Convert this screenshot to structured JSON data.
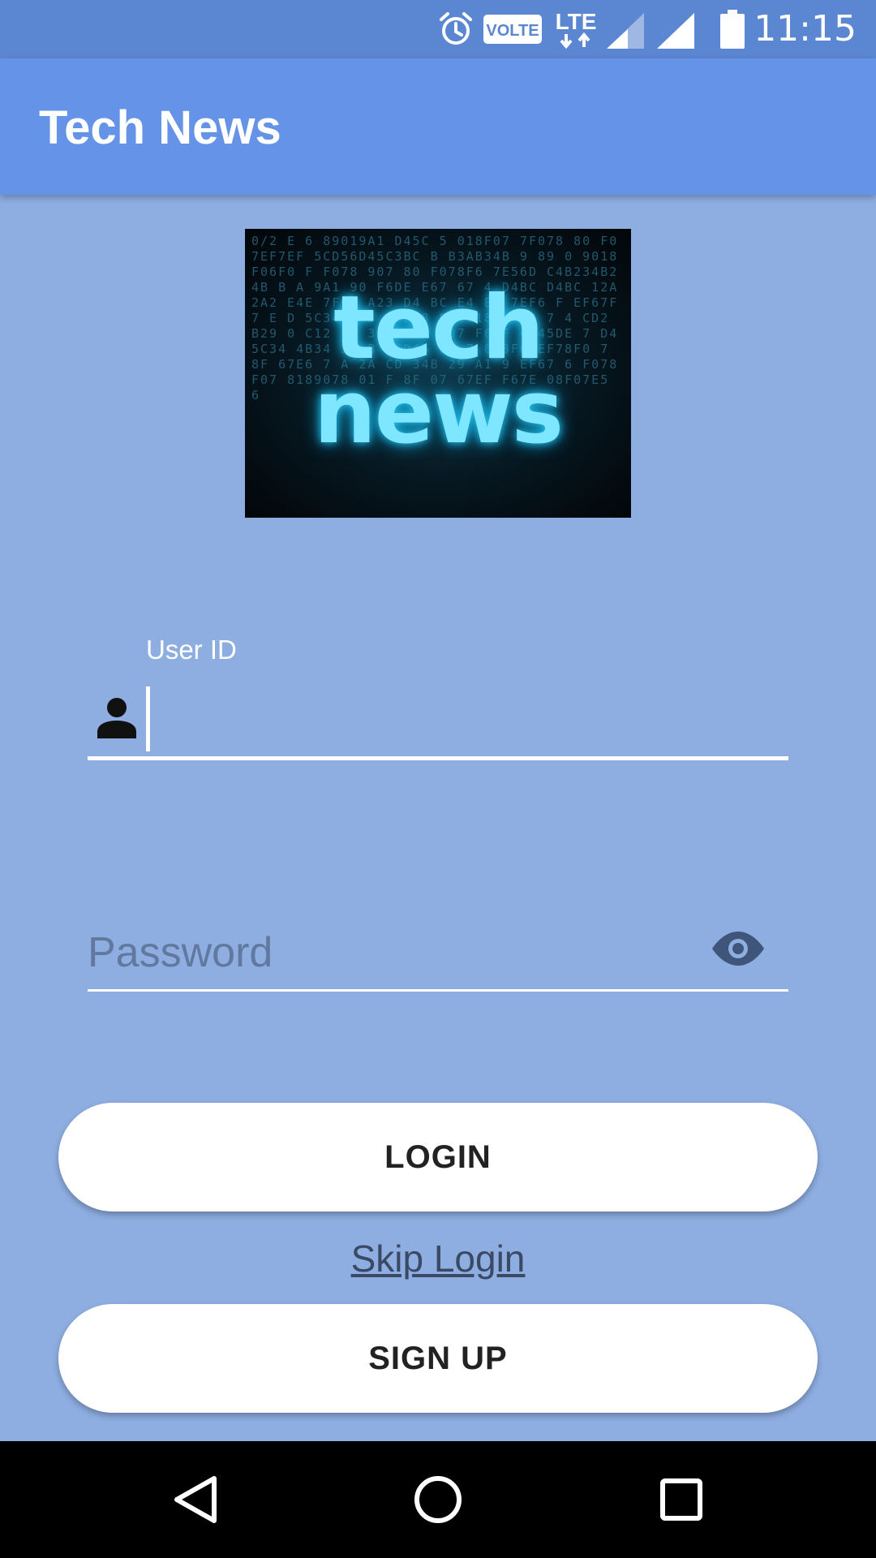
{
  "status_bar": {
    "time": "11:15",
    "volte_label": "VOLTE",
    "network_label": "LTE",
    "icons": [
      "alarm-icon",
      "volte-icon",
      "lte-icon",
      "signal-icon",
      "signal-icon",
      "battery-icon"
    ]
  },
  "app_bar": {
    "title": "Tech News"
  },
  "logo": {
    "line1": "tech",
    "line2": "news",
    "background_text": "0/2 E 6 89019A1 D45C 5 018F07 7F078 80 F07EF7EF 5CD56D45C3BC B B3AB34B 9 89 0 9018F06F0 F F078 907 80 F078F6 7E56D C4B234B24B B A 9A1 90 F6DE E67 67 4 D4BC D4BC 12A 2A2 E4E 7F67 A23 D4 BC E4 E6 7EF6 F EF67F 7 E D 5C345C 3 23B 8 E 9018F 0 3 7 4 CD2 B29 0 C12 9A 34 29 6 F07 F6 F CD45DE 7 D45C34 4B34 3A B 4CD45 2A 7 078F07EF78F0 7 8F 67E6 7 A 2A CD 34B 29 A1 9 EF67 6 F078F07 8189078 01 F 8F 07 67EF F67E 08F07E5 6"
  },
  "form": {
    "userid_label": "User ID",
    "userid_value": "",
    "password_placeholder": "Password",
    "password_value": ""
  },
  "buttons": {
    "login_label": "LOGIN",
    "skip_label": "Skip Login",
    "signup_label": "SIGN UP"
  },
  "nav_bar": {
    "icons": [
      "back-icon",
      "home-icon",
      "recents-icon"
    ]
  },
  "colors": {
    "status_bar": "#5b86d2",
    "app_bar": "#6493e8",
    "background": "#8eaee2",
    "button": "#ffffff",
    "nav_bar": "#000000"
  }
}
